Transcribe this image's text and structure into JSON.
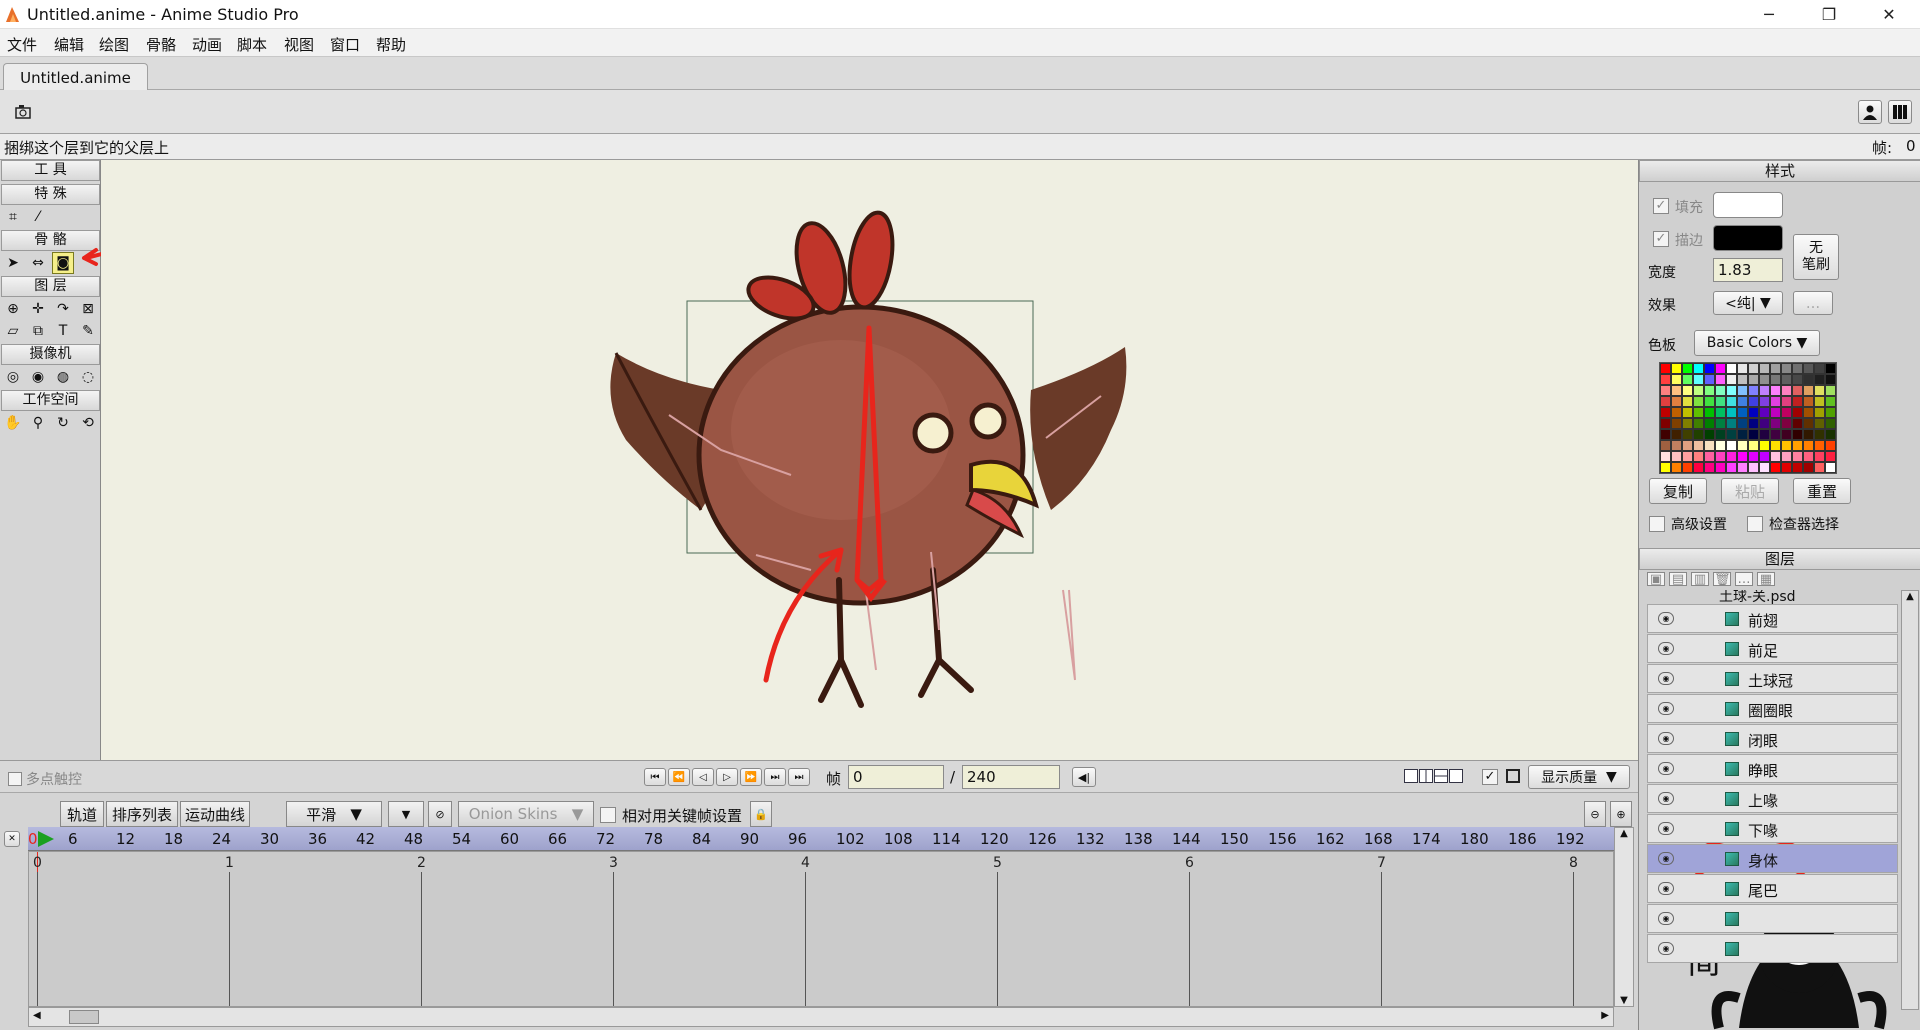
{
  "window": {
    "title": "Untitled.anime - Anime Studio Pro",
    "minimize": "─",
    "maximize": "❐",
    "close": "✕"
  },
  "menu": [
    "文件",
    "编辑",
    "绘图",
    "骨骼",
    "动画",
    "脚本",
    "视图",
    "窗口",
    "帮助"
  ],
  "doc_tab": "Untitled.anime",
  "status": {
    "hint": "捆绑这个层到它的父层上",
    "frame_label": "帧:",
    "frame_value": "0"
  },
  "tools": {
    "title": "工 具",
    "sections": [
      "特  殊",
      "骨  骼",
      "图  层",
      "摄像机",
      "工作空间"
    ]
  },
  "style": {
    "title": "样式",
    "fill_label": "填充",
    "stroke_label": "描边",
    "width_label": "宽度",
    "width_value": "1.83",
    "no_brush": "无\n笔刷",
    "effect_label": "效果",
    "effect_value": "<纯|",
    "effect_more": "...",
    "palette_label": "色板",
    "palette_value": "Basic Colors",
    "copy_btn": "复制",
    "paste_btn": "粘贴",
    "reset_btn": "重置",
    "advanced_label": "高级设置",
    "inspector_label": "检查器选择",
    "fill_color": "#ffffff",
    "stroke_color": "#000000"
  },
  "layers": {
    "title": "图层",
    "group": "土球-关.psd",
    "items": [
      "前翅",
      "前足",
      "土球冠",
      "圈圈眼",
      "闭眼",
      "睁眼",
      "上喙",
      "下喙",
      "身体",
      "尾巴",
      "",
      ""
    ],
    "selected_index": 8
  },
  "transport": {
    "multitouch": "多点触控",
    "frame_label": "帧",
    "frame_value": "0",
    "slash": "/",
    "total_frames": "240",
    "quality": "显示质量"
  },
  "timeline": {
    "tabs": [
      "轨道",
      "排序列表",
      "运动曲线"
    ],
    "interp": "平滑",
    "onion": "Onion Skins",
    "relative_label": "相对用关键帧设置",
    "frame_ticks": [
      "0",
      "6",
      "12",
      "18",
      "24",
      "30",
      "36",
      "42",
      "48",
      "54",
      "60",
      "66",
      "72",
      "78",
      "84",
      "90",
      "96",
      "102",
      "108",
      "114",
      "120",
      "126",
      "132",
      "138",
      "144",
      "150",
      "156",
      "162",
      "168",
      "174",
      "180",
      "186",
      "192"
    ],
    "seconds": [
      "0",
      "1",
      "2",
      "3",
      "4",
      "5",
      "6",
      "7",
      "8"
    ]
  },
  "watermark": "简"
}
